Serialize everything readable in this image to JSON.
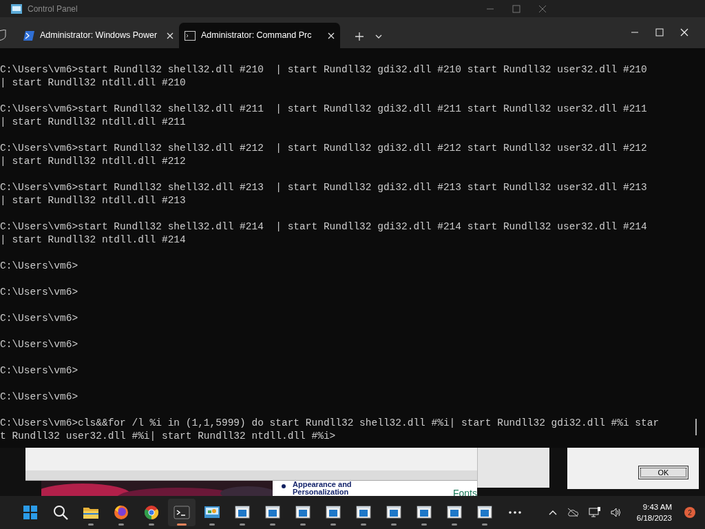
{
  "background_window": {
    "title": "Control Panel"
  },
  "tabs": [
    {
      "kind": "powershell",
      "label": "Administrator: Windows Power",
      "selected": false
    },
    {
      "kind": "cmd",
      "label": "Administrator:  Command Prc",
      "selected": true
    }
  ],
  "terminal": {
    "blocks": [
      [
        "C:\\Users\\vm6>start Rundll32 shell32.dll #210  | start Rundll32 gdi32.dll #210 start Rundll32 user32.dll #210",
        "| start Rundll32 ntdll.dll #210"
      ],
      [
        "C:\\Users\\vm6>start Rundll32 shell32.dll #211  | start Rundll32 gdi32.dll #211 start Rundll32 user32.dll #211",
        "| start Rundll32 ntdll.dll #211"
      ],
      [
        "C:\\Users\\vm6>start Rundll32 shell32.dll #212  | start Rundll32 gdi32.dll #212 start Rundll32 user32.dll #212",
        "| start Rundll32 ntdll.dll #212"
      ],
      [
        "C:\\Users\\vm6>start Rundll32 shell32.dll #213  | start Rundll32 gdi32.dll #213 start Rundll32 user32.dll #213",
        "| start Rundll32 ntdll.dll #213"
      ],
      [
        "C:\\Users\\vm6>start Rundll32 shell32.dll #214  | start Rundll32 gdi32.dll #214 start Rundll32 user32.dll #214",
        "| start Rundll32 ntdll.dll #214"
      ],
      [
        "C:\\Users\\vm6>"
      ],
      [
        "C:\\Users\\vm6>"
      ],
      [
        "C:\\Users\\vm6>"
      ],
      [
        "C:\\Users\\vm6>"
      ],
      [
        "C:\\Users\\vm6>"
      ],
      [
        "C:\\Users\\vm6>"
      ],
      [
        "C:\\Users\\vm6>cls&&for /l %i in (1,1,5999) do start Rundll32 shell32.dll #%i| start Rundll32 gdi32.dll #%i star",
        "t Rundll32 user32.dll #%i| start Rundll32 ntdll.dll #%i>"
      ]
    ]
  },
  "behind": {
    "link": "Appearance and",
    "link_cont": "Personalization",
    "fonts": "Fonts",
    "ok": "OK"
  },
  "taskbar": {
    "apps": [
      {
        "kind": "start",
        "selected": false
      },
      {
        "kind": "search",
        "selected": false
      },
      {
        "kind": "folder",
        "selected": false
      },
      {
        "kind": "firefox",
        "selected": false
      },
      {
        "kind": "chrome",
        "selected": false
      },
      {
        "kind": "terminal",
        "selected": true
      },
      {
        "kind": "control",
        "selected": false
      },
      {
        "kind": "window",
        "selected": false
      },
      {
        "kind": "window",
        "selected": false
      },
      {
        "kind": "window",
        "selected": false
      },
      {
        "kind": "window",
        "selected": false
      },
      {
        "kind": "window",
        "selected": false
      },
      {
        "kind": "window",
        "selected": false
      },
      {
        "kind": "window",
        "selected": false
      },
      {
        "kind": "window",
        "selected": false
      },
      {
        "kind": "window",
        "selected": false
      },
      {
        "kind": "more",
        "selected": false
      }
    ],
    "time": "9:43 AM",
    "date": "6/18/2023",
    "notifications": "2"
  }
}
